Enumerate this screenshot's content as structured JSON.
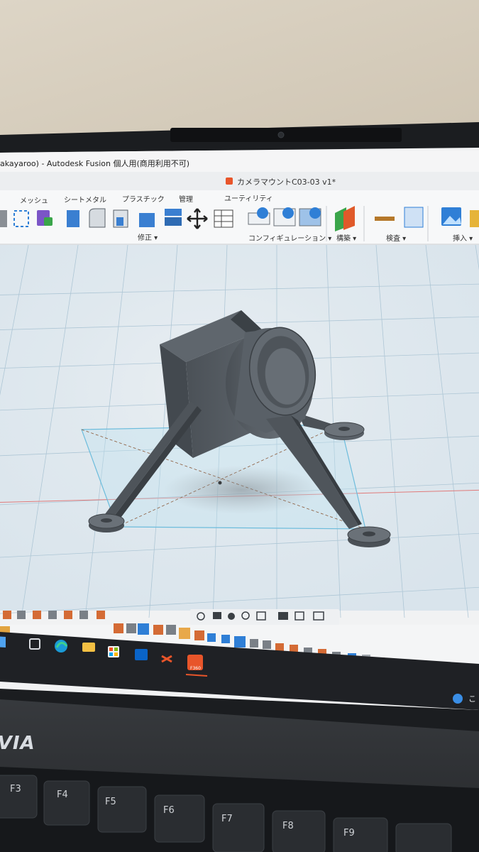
{
  "window": {
    "title": "akayaroo) - Autodesk Fusion 個人用(商用利用不可)",
    "document_tab": "カメラマウントC03-03 v1*"
  },
  "ribbon": {
    "tabs": [
      "メッシュ",
      "シートメタル",
      "プラスチック",
      "管理",
      "ユーティリティ"
    ],
    "groups": [
      "修正 ▾",
      "コンフィギュレーション ▾",
      "構築 ▾",
      "検査 ▾",
      "挿入 ▾"
    ]
  },
  "taskbar": {
    "apps": [
      "windows-start-icon",
      "task-view-icon",
      "edge-icon",
      "file-explorer-icon",
      "microsoft-store-icon",
      "outlook-icon",
      "drone-app-icon",
      "fusion-icon"
    ],
    "fusion_label": "F360",
    "tray_text": "こ"
  },
  "laptop": {
    "brand": "NVIA",
    "keys": [
      "F3",
      "F4",
      "F5",
      "F6",
      "F7",
      "F8",
      "F9"
    ]
  },
  "colors": {
    "wall": "#d8cfbf",
    "bezel": "#1e2023",
    "viewport": "#dfe7ee",
    "model": "#5a6168",
    "grid_line": "#a9c3d3",
    "sketch_plane": "#7fc2de",
    "fusion_orange": "#e8552a"
  }
}
